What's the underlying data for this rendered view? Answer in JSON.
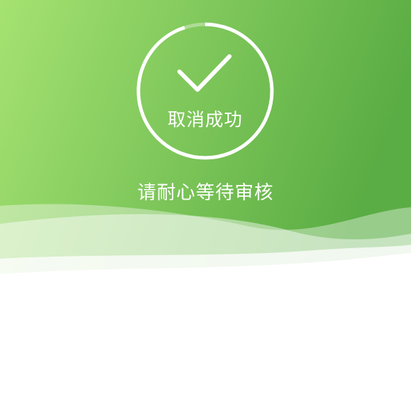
{
  "status": {
    "title": "取消成功",
    "message": "请耐心等待审核",
    "icon": "checkmark-icon",
    "progress_ring_fraction": 0.95
  },
  "colors": {
    "gradient_start": "#a5e272",
    "gradient_end": "#5aad44",
    "text": "#ffffff",
    "background": "#ffffff"
  }
}
